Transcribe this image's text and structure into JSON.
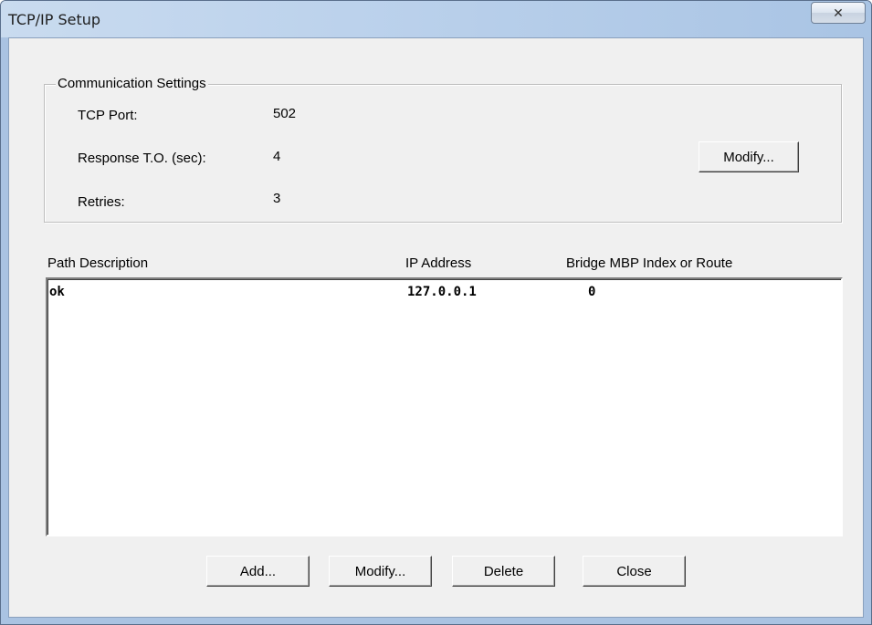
{
  "window": {
    "title": "TCP/IP Setup",
    "close_glyph": "✕"
  },
  "comm": {
    "legend": "Communication Settings",
    "tcp_port_label": "TCP Port:",
    "tcp_port_value": "502",
    "response_label": "Response T.O. (sec):",
    "response_value": "4",
    "retries_label": "Retries:",
    "retries_value": "3",
    "modify_label": "Modify..."
  },
  "table": {
    "headers": [
      "Path Description",
      "IP Address",
      "Bridge MBP Index or Route"
    ],
    "rows": [
      [
        "ok",
        "127.0.0.1",
        "0"
      ]
    ]
  },
  "buttons": {
    "add": "Add...",
    "modify": "Modify...",
    "delete": "Delete",
    "close": "Close"
  }
}
